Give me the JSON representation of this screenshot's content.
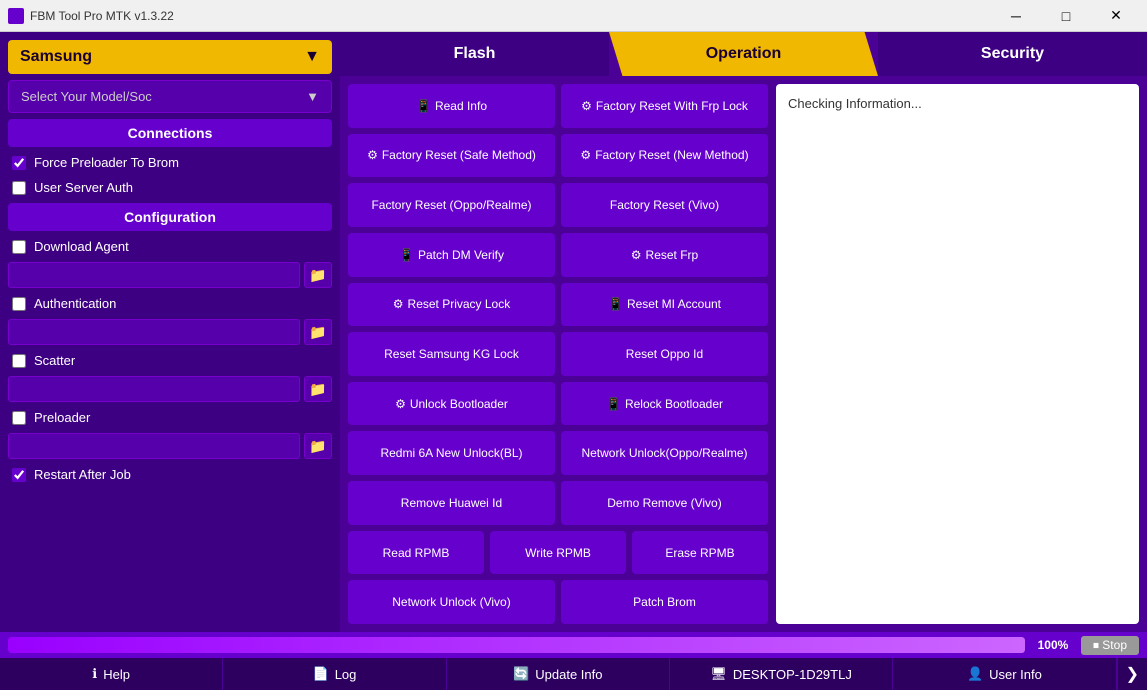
{
  "titlebar": {
    "title": "FBM Tool Pro MTK v1.3.22",
    "icon": "⚙",
    "minimize": "─",
    "maximize": "□",
    "close": "✕"
  },
  "sidebar": {
    "brand_label": "Samsung",
    "brand_arrow": "▼",
    "model_placeholder": "Select Your Model/Soc",
    "model_arrow": "▼",
    "connections_label": "Connections",
    "force_preloader_label": "Force Preloader To  Brom",
    "force_preloader_checked": true,
    "user_server_label": "User Server Auth",
    "user_server_checked": false,
    "configuration_label": "Configuration",
    "download_agent_label": "Download Agent",
    "download_agent_checked": false,
    "authentication_label": "Authentication",
    "authentication_checked": false,
    "scatter_label": "Scatter",
    "scatter_checked": false,
    "preloader_label": "Preloader",
    "preloader_checked": false,
    "restart_label": "Restart After Job",
    "restart_checked": true
  },
  "tabs": [
    {
      "id": "flash",
      "label": "Flash",
      "active": false
    },
    {
      "id": "operation",
      "label": "Operation",
      "active": true
    },
    {
      "id": "security",
      "label": "Security",
      "active": false
    }
  ],
  "buttons": [
    {
      "id": "read-info",
      "label": "Read Info",
      "icon": "📱",
      "span": 1,
      "col": 1
    },
    {
      "id": "factory-reset-frp",
      "label": "Factory Reset With Frp Lock",
      "icon": "⚙",
      "span": 1,
      "col": 2
    },
    {
      "id": "factory-reset-safe",
      "label": "Factory Reset (Safe Method)",
      "icon": "⚙",
      "span": 1,
      "col": 1
    },
    {
      "id": "factory-reset-new",
      "label": "Factory Reset (New Method)",
      "icon": "⚙",
      "span": 1,
      "col": 2
    },
    {
      "id": "factory-reset-oppo",
      "label": "Factory Reset (Oppo/Realme)",
      "icon": "",
      "span": 1,
      "col": 1
    },
    {
      "id": "factory-reset-vivo",
      "label": "Factory Reset (Vivo)",
      "icon": "",
      "span": 1,
      "col": 2
    },
    {
      "id": "patch-dm-verify",
      "label": "Patch DM Verify",
      "icon": "📱",
      "span": 1,
      "col": 1
    },
    {
      "id": "reset-frp",
      "label": "Reset Frp",
      "icon": "⚙",
      "span": 1,
      "col": 2
    },
    {
      "id": "reset-privacy-lock",
      "label": "Reset Privacy Lock",
      "icon": "⚙",
      "span": 1,
      "col": 1
    },
    {
      "id": "reset-mi-account",
      "label": "Reset MI Account",
      "icon": "📱",
      "span": 1,
      "col": 2
    },
    {
      "id": "reset-samsung-kg",
      "label": "Reset Samsung KG Lock",
      "icon": "",
      "span": 1,
      "col": 1
    },
    {
      "id": "reset-oppo-id",
      "label": "Reset Oppo Id",
      "icon": "",
      "span": 1,
      "col": 2
    },
    {
      "id": "unlock-bootloader",
      "label": "Unlock Bootloader",
      "icon": "⚙",
      "span": 1,
      "col": 1
    },
    {
      "id": "relock-bootloader",
      "label": "Relock Bootloader",
      "icon": "📱",
      "span": 1,
      "col": 2
    },
    {
      "id": "redmi-6a-unlock",
      "label": "Redmi 6A New Unlock(BL)",
      "icon": "",
      "span": 1,
      "col": 1
    },
    {
      "id": "network-unlock-oppo",
      "label": "Network Unlock(Oppo/Realme)",
      "icon": "",
      "span": 1,
      "col": 2
    },
    {
      "id": "remove-huawei",
      "label": "Remove Huawei Id",
      "icon": "",
      "span": 1,
      "col": 1
    },
    {
      "id": "demo-remove-vivo",
      "label": "Demo Remove (Vivo)",
      "icon": "",
      "span": 1,
      "col": 2
    },
    {
      "id": "network-unlock-vivo",
      "label": "Network Unlock (Vivo)",
      "icon": "",
      "span": 1,
      "col": 1
    },
    {
      "id": "patch-brom",
      "label": "Patch Brom",
      "icon": "",
      "span": 1,
      "col": 2
    }
  ],
  "rpmb": {
    "read_label": "Read RPMB",
    "write_label": "Write RPMB",
    "erase_label": "Erase RPMB"
  },
  "info_panel": {
    "text": "Checking Information..."
  },
  "progress": {
    "percent": "100%",
    "fill_width": "100%",
    "stop_label": "⏹ Stop"
  },
  "bottom_bar": [
    {
      "id": "help",
      "icon": "?",
      "label": "Help"
    },
    {
      "id": "log",
      "icon": "📄",
      "label": "Log"
    },
    {
      "id": "update",
      "icon": "🔄",
      "label": "Update Info"
    },
    {
      "id": "desktop",
      "icon": "🖥",
      "label": "DESKTOP-1D29TLJ"
    },
    {
      "id": "user",
      "icon": "👤",
      "label": "User Info"
    }
  ],
  "arrow_label": "❯"
}
